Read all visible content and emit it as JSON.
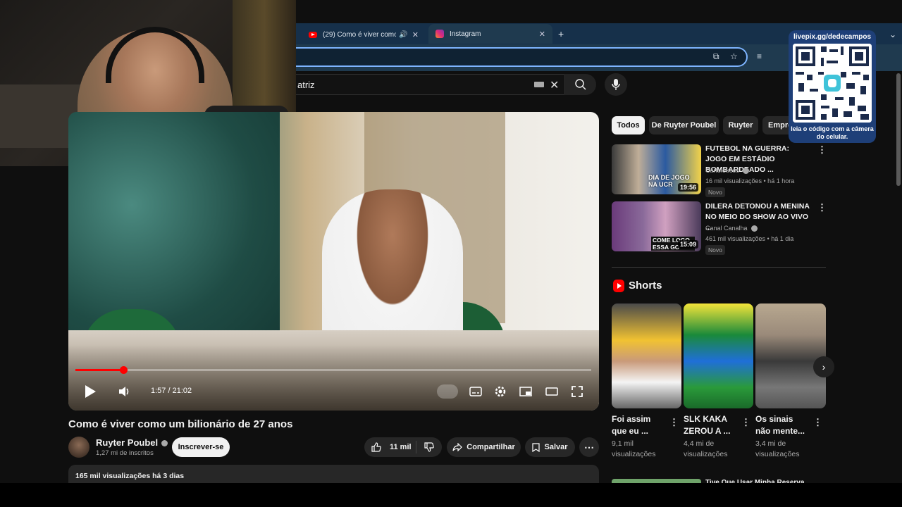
{
  "browser": {
    "tabs": [
      {
        "title": "(29) Como é viver como um bilionário",
        "icon": "youtube-favicon"
      },
      {
        "title": "Instagram",
        "icon": "instagram-favicon"
      }
    ],
    "new_tab_icon": "plus-icon"
  },
  "youtube": {
    "search_value": "atriz",
    "search_icon": "search-icon",
    "mic_icon": "mic-icon"
  },
  "overlay": {
    "qr_url": "livepix.gg/dedecampos",
    "qr_caption": "leia o código com a câmera do celular."
  },
  "player": {
    "time": "1:57 / 21:02",
    "progress_fraction": 0.093,
    "accent": "#ff0000"
  },
  "video": {
    "title": "Como é viver como um bilionário de 27 anos",
    "channel": "Ruyter Poubel",
    "subscribers": "1,27 mi de inscritos",
    "subscribe_label": "Inscrever-se",
    "likes": "11 mil",
    "share_label": "Compartilhar",
    "save_label": "Salvar",
    "desc_stats": "165 mil visualizações  há 3 dias"
  },
  "chips": [
    "Todos",
    "De Ruyter Poubel",
    "Ruyter",
    "Empre"
  ],
  "recommendations": [
    {
      "title": "FUTEBOL NA GUERRA: JOGO EM ESTÁDIO BOMBARDEADO ...",
      "channel": "Cartoloucos",
      "meta": "16 mil visualizações • há 1 hora",
      "badge": "Novo",
      "duration": "19:56",
      "thumb_text": "DIA DE JOGO NA UCR"
    },
    {
      "title": "DILERA DETONOU A MENINA NO MEIO DO SHOW AO VIVO ...",
      "channel": "Canal Canalha",
      "meta": "461 mil visualizações • há 1 dia",
      "badge": "Novo",
      "duration": "15:09",
      "thumb_text": "COME LOGO ESSA GO"
    }
  ],
  "shorts": {
    "heading": "Shorts",
    "items": [
      {
        "title": "Foi assim que eu ...",
        "views": "9,1 mil visualizações"
      },
      {
        "title": "SLK KAKA ZEROU A ...",
        "views": "4,4 mi de visualizações"
      },
      {
        "title": "Os sinais não mente...",
        "views": "3,4 mi de visualizações"
      }
    ]
  },
  "rec3_title": "Tive Que Usar Minha Reserva..."
}
